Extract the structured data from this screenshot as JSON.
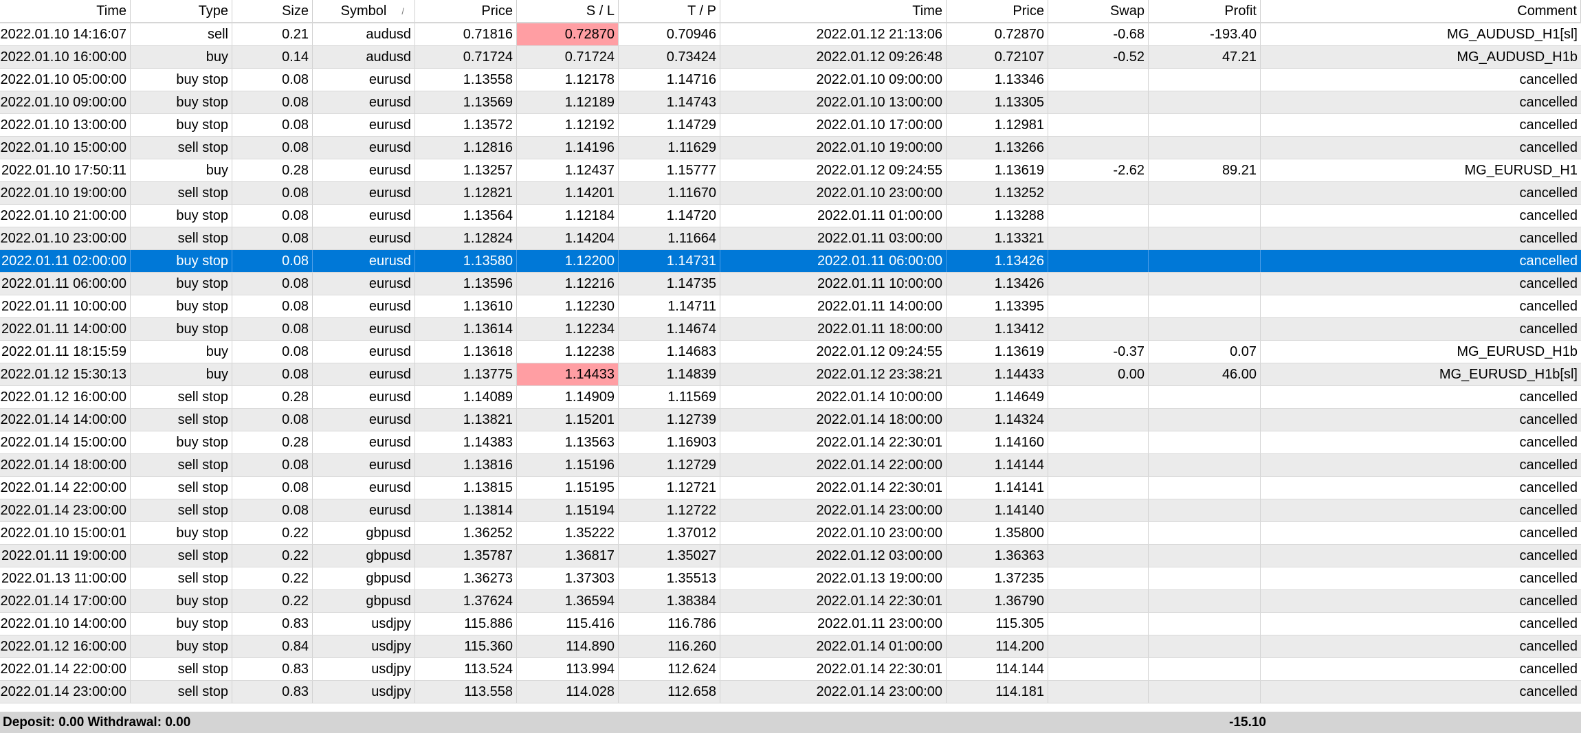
{
  "columns": [
    "Time",
    "Type",
    "Size",
    "Symbol",
    "Price",
    "S / L",
    "T / P",
    "Time",
    "Price",
    "Swap",
    "Profit",
    "Comment"
  ],
  "sort_indicator": "/",
  "rows": [
    [
      "2022.01.10 14:16:07",
      "sell",
      "0.21",
      "audusd",
      "0.71816",
      "0.72870",
      "0.70946",
      "2022.01.12 21:13:06",
      "0.72870",
      "-0.68",
      "-193.40",
      "MG_AUDUSD_H1[sl]"
    ],
    [
      "2022.01.10 16:00:00",
      "buy",
      "0.14",
      "audusd",
      "0.71724",
      "0.71724",
      "0.73424",
      "2022.01.12 09:26:48",
      "0.72107",
      "-0.52",
      "47.21",
      "MG_AUDUSD_H1b"
    ],
    [
      "2022.01.10 05:00:00",
      "buy stop",
      "0.08",
      "eurusd",
      "1.13558",
      "1.12178",
      "1.14716",
      "2022.01.10 09:00:00",
      "1.13346",
      "",
      "",
      "cancelled"
    ],
    [
      "2022.01.10 09:00:00",
      "buy stop",
      "0.08",
      "eurusd",
      "1.13569",
      "1.12189",
      "1.14743",
      "2022.01.10 13:00:00",
      "1.13305",
      "",
      "",
      "cancelled"
    ],
    [
      "2022.01.10 13:00:00",
      "buy stop",
      "0.08",
      "eurusd",
      "1.13572",
      "1.12192",
      "1.14729",
      "2022.01.10 17:00:00",
      "1.12981",
      "",
      "",
      "cancelled"
    ],
    [
      "2022.01.10 15:00:00",
      "sell stop",
      "0.08",
      "eurusd",
      "1.12816",
      "1.14196",
      "1.11629",
      "2022.01.10 19:00:00",
      "1.13266",
      "",
      "",
      "cancelled"
    ],
    [
      "2022.01.10 17:50:11",
      "buy",
      "0.28",
      "eurusd",
      "1.13257",
      "1.12437",
      "1.15777",
      "2022.01.12 09:24:55",
      "1.13619",
      "-2.62",
      "89.21",
      "MG_EURUSD_H1"
    ],
    [
      "2022.01.10 19:00:00",
      "sell stop",
      "0.08",
      "eurusd",
      "1.12821",
      "1.14201",
      "1.11670",
      "2022.01.10 23:00:00",
      "1.13252",
      "",
      "",
      "cancelled"
    ],
    [
      "2022.01.10 21:00:00",
      "buy stop",
      "0.08",
      "eurusd",
      "1.13564",
      "1.12184",
      "1.14720",
      "2022.01.11 01:00:00",
      "1.13288",
      "",
      "",
      "cancelled"
    ],
    [
      "2022.01.10 23:00:00",
      "sell stop",
      "0.08",
      "eurusd",
      "1.12824",
      "1.14204",
      "1.11664",
      "2022.01.11 03:00:00",
      "1.13321",
      "",
      "",
      "cancelled"
    ],
    [
      "2022.01.11 02:00:00",
      "buy stop",
      "0.08",
      "eurusd",
      "1.13580",
      "1.12200",
      "1.14731",
      "2022.01.11 06:00:00",
      "1.13426",
      "",
      "",
      "cancelled"
    ],
    [
      "2022.01.11 06:00:00",
      "buy stop",
      "0.08",
      "eurusd",
      "1.13596",
      "1.12216",
      "1.14735",
      "2022.01.11 10:00:00",
      "1.13426",
      "",
      "",
      "cancelled"
    ],
    [
      "2022.01.11 10:00:00",
      "buy stop",
      "0.08",
      "eurusd",
      "1.13610",
      "1.12230",
      "1.14711",
      "2022.01.11 14:00:00",
      "1.13395",
      "",
      "",
      "cancelled"
    ],
    [
      "2022.01.11 14:00:00",
      "buy stop",
      "0.08",
      "eurusd",
      "1.13614",
      "1.12234",
      "1.14674",
      "2022.01.11 18:00:00",
      "1.13412",
      "",
      "",
      "cancelled"
    ],
    [
      "2022.01.11 18:15:59",
      "buy",
      "0.08",
      "eurusd",
      "1.13618",
      "1.12238",
      "1.14683",
      "2022.01.12 09:24:55",
      "1.13619",
      "-0.37",
      "0.07",
      "MG_EURUSD_H1b"
    ],
    [
      "2022.01.12 15:30:13",
      "buy",
      "0.08",
      "eurusd",
      "1.13775",
      "1.14433",
      "1.14839",
      "2022.01.12 23:38:21",
      "1.14433",
      "0.00",
      "46.00",
      "MG_EURUSD_H1b[sl]"
    ],
    [
      "2022.01.12 16:00:00",
      "sell stop",
      "0.28",
      "eurusd",
      "1.14089",
      "1.14909",
      "1.11569",
      "2022.01.14 10:00:00",
      "1.14649",
      "",
      "",
      "cancelled"
    ],
    [
      "2022.01.14 14:00:00",
      "sell stop",
      "0.08",
      "eurusd",
      "1.13821",
      "1.15201",
      "1.12739",
      "2022.01.14 18:00:00",
      "1.14324",
      "",
      "",
      "cancelled"
    ],
    [
      "2022.01.14 15:00:00",
      "buy stop",
      "0.28",
      "eurusd",
      "1.14383",
      "1.13563",
      "1.16903",
      "2022.01.14 22:30:01",
      "1.14160",
      "",
      "",
      "cancelled"
    ],
    [
      "2022.01.14 18:00:00",
      "sell stop",
      "0.08",
      "eurusd",
      "1.13816",
      "1.15196",
      "1.12729",
      "2022.01.14 22:00:00",
      "1.14144",
      "",
      "",
      "cancelled"
    ],
    [
      "2022.01.14 22:00:00",
      "sell stop",
      "0.08",
      "eurusd",
      "1.13815",
      "1.15195",
      "1.12721",
      "2022.01.14 22:30:01",
      "1.14141",
      "",
      "",
      "cancelled"
    ],
    [
      "2022.01.14 23:00:00",
      "sell stop",
      "0.08",
      "eurusd",
      "1.13814",
      "1.15194",
      "1.12722",
      "2022.01.14 23:00:00",
      "1.14140",
      "",
      "",
      "cancelled"
    ],
    [
      "2022.01.10 15:00:01",
      "buy stop",
      "0.22",
      "gbpusd",
      "1.36252",
      "1.35222",
      "1.37012",
      "2022.01.10 23:00:00",
      "1.35800",
      "",
      "",
      "cancelled"
    ],
    [
      "2022.01.11 19:00:00",
      "sell stop",
      "0.22",
      "gbpusd",
      "1.35787",
      "1.36817",
      "1.35027",
      "2022.01.12 03:00:00",
      "1.36363",
      "",
      "",
      "cancelled"
    ],
    [
      "2022.01.13 11:00:00",
      "sell stop",
      "0.22",
      "gbpusd",
      "1.36273",
      "1.37303",
      "1.35513",
      "2022.01.13 19:00:00",
      "1.37235",
      "",
      "",
      "cancelled"
    ],
    [
      "2022.01.14 17:00:00",
      "buy stop",
      "0.22",
      "gbpusd",
      "1.37624",
      "1.36594",
      "1.38384",
      "2022.01.14 22:30:01",
      "1.36790",
      "",
      "",
      "cancelled"
    ],
    [
      "2022.01.10 14:00:00",
      "buy stop",
      "0.83",
      "usdjpy",
      "115.886",
      "115.416",
      "116.786",
      "2022.01.11 23:00:00",
      "115.305",
      "",
      "",
      "cancelled"
    ],
    [
      "2022.01.12 16:00:00",
      "buy stop",
      "0.84",
      "usdjpy",
      "115.360",
      "114.890",
      "116.260",
      "2022.01.14 01:00:00",
      "114.200",
      "",
      "",
      "cancelled"
    ],
    [
      "2022.01.14 22:00:00",
      "sell stop",
      "0.83",
      "usdjpy",
      "113.524",
      "113.994",
      "112.624",
      "2022.01.14 22:30:01",
      "114.144",
      "",
      "",
      "cancelled"
    ],
    [
      "2022.01.14 23:00:00",
      "sell stop",
      "0.83",
      "usdjpy",
      "113.558",
      "114.028",
      "112.658",
      "2022.01.14 23:00:00",
      "114.181",
      "",
      "",
      "cancelled"
    ]
  ],
  "selected_row": 10,
  "sl_highlight_rows": [
    0,
    15
  ],
  "highlight_color": "#ff9ea3",
  "selection_color": "#0078d7",
  "footer": {
    "summary": "Deposit: 0.00  Withdrawal: 0.00",
    "profit_total": "-15.10"
  }
}
